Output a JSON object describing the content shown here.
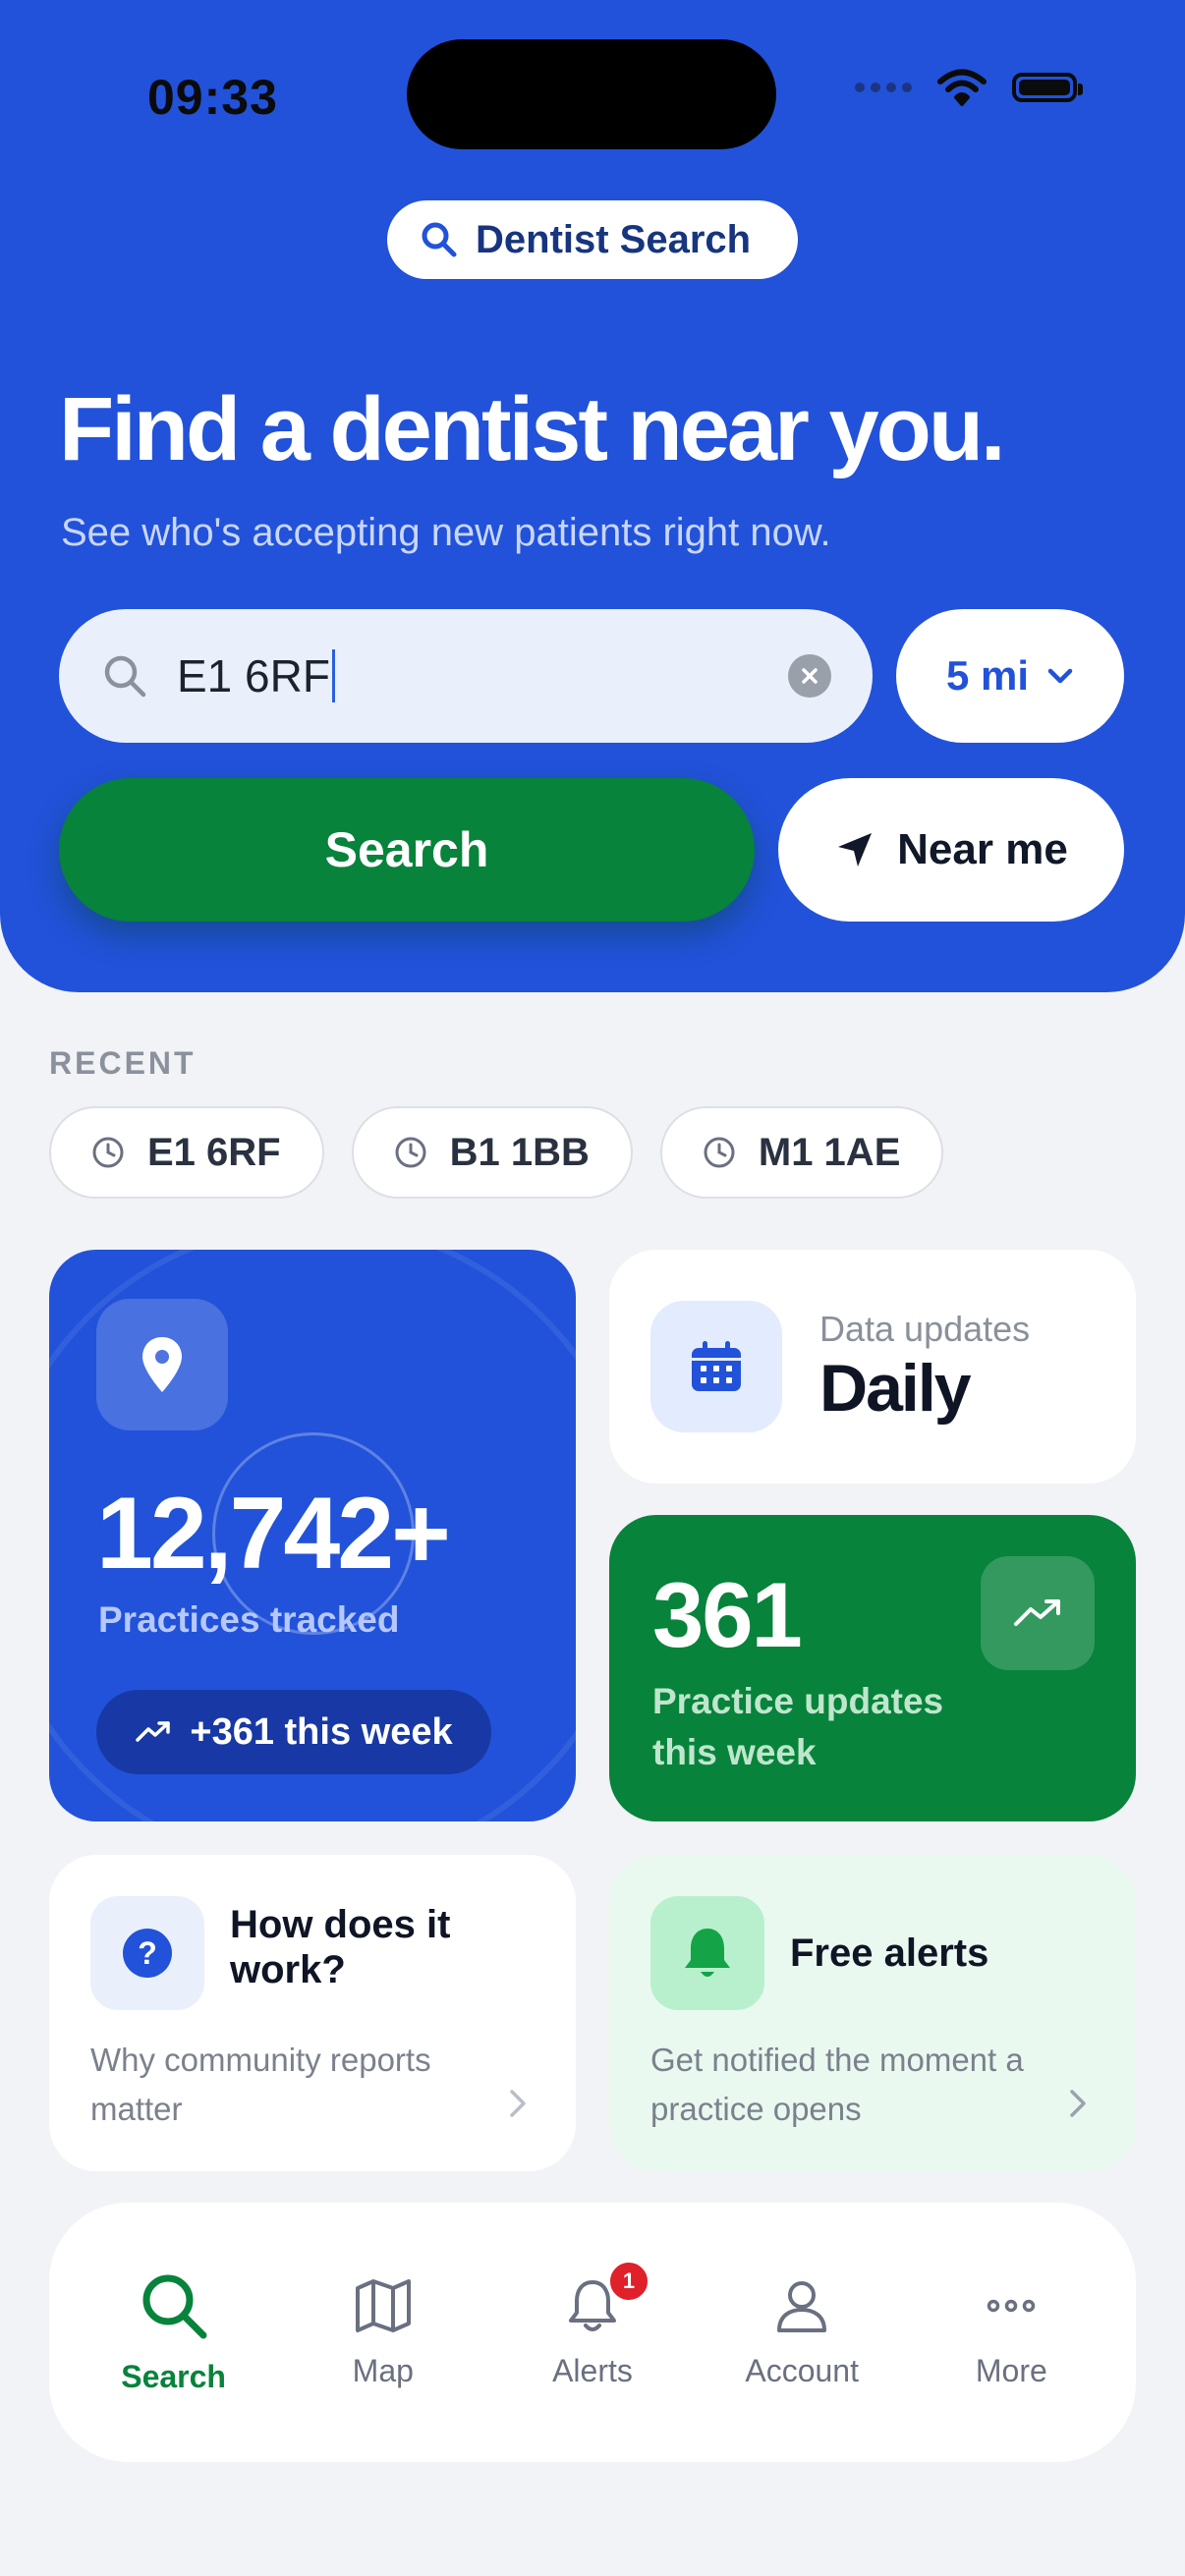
{
  "status": {
    "time": "09:33"
  },
  "header": {
    "app_title": "Dentist Search"
  },
  "hero": {
    "headline": "Find a dentist near you.",
    "subline": "See who's accepting new patients right now."
  },
  "search": {
    "value": "E1 6RF",
    "radius": "5 mi",
    "search_label": "Search",
    "near_me_label": "Near me"
  },
  "recent": {
    "label": "RECENT",
    "items": [
      "E1 6RF",
      "B1 1BB",
      "M1 1AE"
    ]
  },
  "stats": {
    "practices_count": "12,742+",
    "practices_label": "Practices tracked",
    "week_change": "+361 this week",
    "data_updates_label": "Data updates",
    "data_updates_value": "Daily",
    "practice_updates_count": "361",
    "practice_updates_label": "Practice updates this week"
  },
  "tiles": {
    "how": {
      "title": "How does it work?",
      "desc": "Why community reports matter"
    },
    "alerts": {
      "title": "Free alerts",
      "desc": "Get notified the moment a practice opens"
    }
  },
  "tabbar": {
    "items": [
      {
        "label": "Search",
        "icon": "search-icon"
      },
      {
        "label": "Map",
        "icon": "map-icon"
      },
      {
        "label": "Alerts",
        "icon": "bell-icon"
      },
      {
        "label": "Account",
        "icon": "person-icon"
      },
      {
        "label": "More",
        "icon": "more-icon"
      }
    ],
    "alerts_badge": "1"
  },
  "colors": {
    "brand_blue": "#2152d9",
    "brand_green": "#07833b",
    "badge_red": "#e0202a"
  }
}
